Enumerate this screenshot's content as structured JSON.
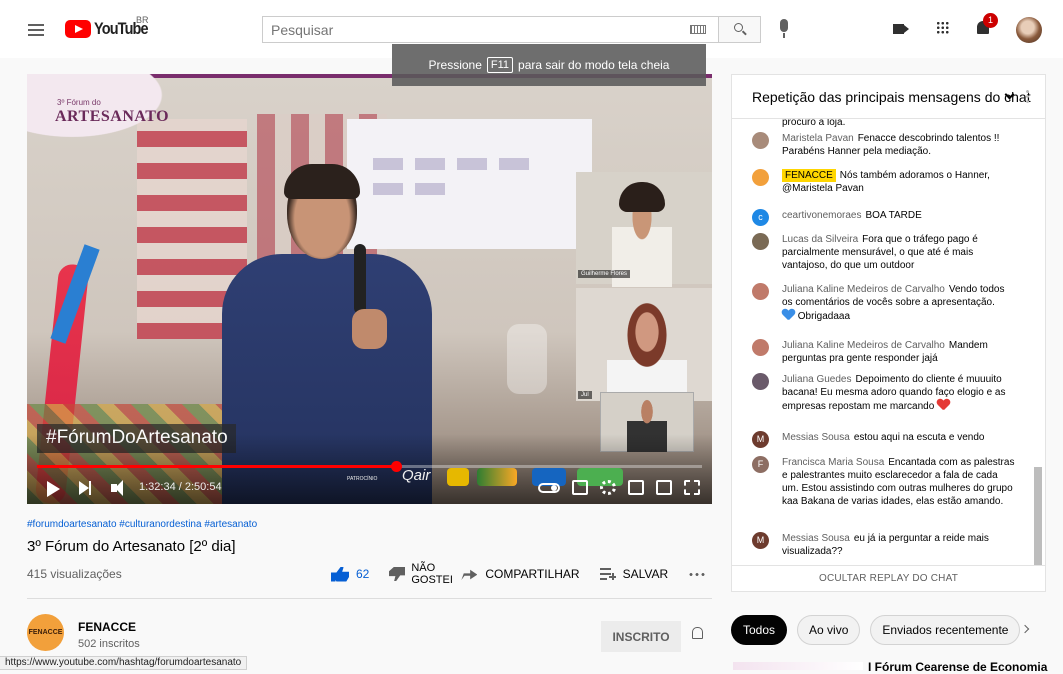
{
  "header": {
    "logo_text": "YouTube",
    "country_code": "BR",
    "search_placeholder": "Pesquisar",
    "notification_count": "1"
  },
  "player": {
    "fullscreen_toast": {
      "before": "Pressione",
      "key": "F11",
      "after": "para sair do modo tela cheia"
    },
    "overlay_hashtag": "#FórumDoArtesanato",
    "event_small": "3º Fórum do",
    "event_big": "ARTESANATO",
    "participant_1": "Guilherme Flores",
    "participant_2": "Jul",
    "sponsor_label": "PATROCÍNIO",
    "sponsor_1": "Qair",
    "time_current": "1:32:34",
    "time_total": "2:50:54",
    "progress_fraction": 0.54
  },
  "video": {
    "hashtags": "#forumdoartesanato #culturanordestina #artesanato",
    "title": "3º Fórum do Artesanato [2º dia]",
    "views": "415 visualizações",
    "like_count": "62",
    "dislike_label": "NÃO GOSTEI",
    "share_label": "COMPARTILHAR",
    "save_label": "SALVAR"
  },
  "channel": {
    "name": "FENACCE",
    "subscribers": "502 inscritos",
    "avatar_text": "FENACCE",
    "subscribe_label": "INSCRITO"
  },
  "status_url": "https://www.youtube.com/hashtag/forumdoartesanato",
  "chat": {
    "title": "Repetição das principais mensagens do chat",
    "footer": "OCULTAR REPLAY DO CHAT",
    "messages": [
      {
        "author": "",
        "text": "procuro a loja.",
        "avatar": "",
        "color": "#ffffff"
      },
      {
        "author": "Maristela Pavan",
        "text": "Fenacce descobrindo talentos !! Parabéns Hanner pela mediação.",
        "avatar": "",
        "color": "#a88b7a"
      },
      {
        "author": "FENACCE",
        "text": "Nós também adoramos o Hanner, @Maristela Pavan",
        "avatar": "",
        "color": "#f2a03b"
      },
      {
        "author": "ceartivonemoraes",
        "text": "BOA TARDE",
        "avatar": "c",
        "color": "#1e88e5"
      },
      {
        "author": "Lucas da Silveira",
        "text": "Fora que o tráfego pago é parcialmente mensurável, o que até é mais vantajoso, do que um outdoor",
        "avatar": "",
        "color": "#7a6a55"
      },
      {
        "author": "Juliana Kaline Medeiros de Carvalho",
        "text": "Vendo todos os comentários de vocês sobre a apresentação.",
        "text2": "Obrigadaaa",
        "avatar": "",
        "color": "#c07a6a"
      },
      {
        "author": "Juliana Kaline Medeiros de Carvalho",
        "text": "Mandem perguntas pra gente responder jajá",
        "avatar": "",
        "color": "#c07a6a"
      },
      {
        "author": "Juliana Guedes",
        "text": "Depoimento do cliente é muuuito bacana! Eu mesma adoro quando faço elogio e as empresas repostam me marcando",
        "avatar": "",
        "color": "#6a5a6a"
      },
      {
        "author": "Messias Sousa",
        "text": "estou aqui na escuta e vendo",
        "avatar": "M",
        "color": "#6d3b2e"
      },
      {
        "author": "Francisca Maria Sousa",
        "text": "Encantada com as palestras e palestrantes muito esclarecedor a fala de cada um. Estou assistindo com outras mulheres do grupo kaa Bakana de varias idades, elas estão amando.",
        "avatar": "F",
        "color": "#8d6e63"
      },
      {
        "author": "Messias Sousa",
        "text": "eu já ia perguntar a reide mais visualizada??",
        "avatar": "M",
        "color": "#6d3b2e"
      }
    ]
  },
  "chips": [
    "Todos",
    "Ao vivo",
    "Enviados recentemente"
  ],
  "recommendation": {
    "title": "I Fórum Cearense de Economia"
  }
}
